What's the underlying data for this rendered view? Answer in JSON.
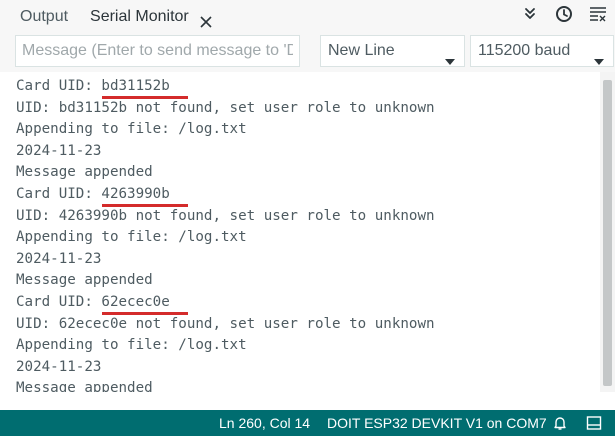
{
  "tabs": [
    {
      "label": "Output",
      "active": false
    },
    {
      "label": "Serial Monitor",
      "active": true
    }
  ],
  "toolbar": {
    "message_placeholder": "Message (Enter to send message to 'D…",
    "line_ending": "New Line",
    "baud_rate": "115200 baud"
  },
  "output": {
    "lines": [
      "Card UID: bd31152b",
      "UID: bd31152b not found, set user role to unknown",
      "Appending to file: /log.txt",
      "2024-11-23",
      "Message appended",
      "Card UID: 4263990b",
      "UID: 4263990b not found, set user role to unknown",
      "Appending to file: /log.txt",
      "2024-11-23",
      "Message appended",
      "Card UID: 62ecec0e",
      "UID: 62ecec0e not found, set user role to unknown",
      "Appending to file: /log.txt",
      "2024-11-23",
      "Message appended"
    ]
  },
  "statusbar": {
    "position": "Ln 260, Col 14",
    "board": "DOIT ESP32 DEVKIT V1 on COM7"
  },
  "icons": {
    "tab_close": "close-icon",
    "toggle_autoscroll": "double-chevron-down-icon",
    "toggle_timestamp": "clock-icon",
    "clear_output": "clear-output-icon",
    "notifications": "bell-icon",
    "toggle_panel": "panel-icon"
  },
  "colors": {
    "statusbar": "#006d70",
    "highlight_underline": "#d42b2b"
  }
}
